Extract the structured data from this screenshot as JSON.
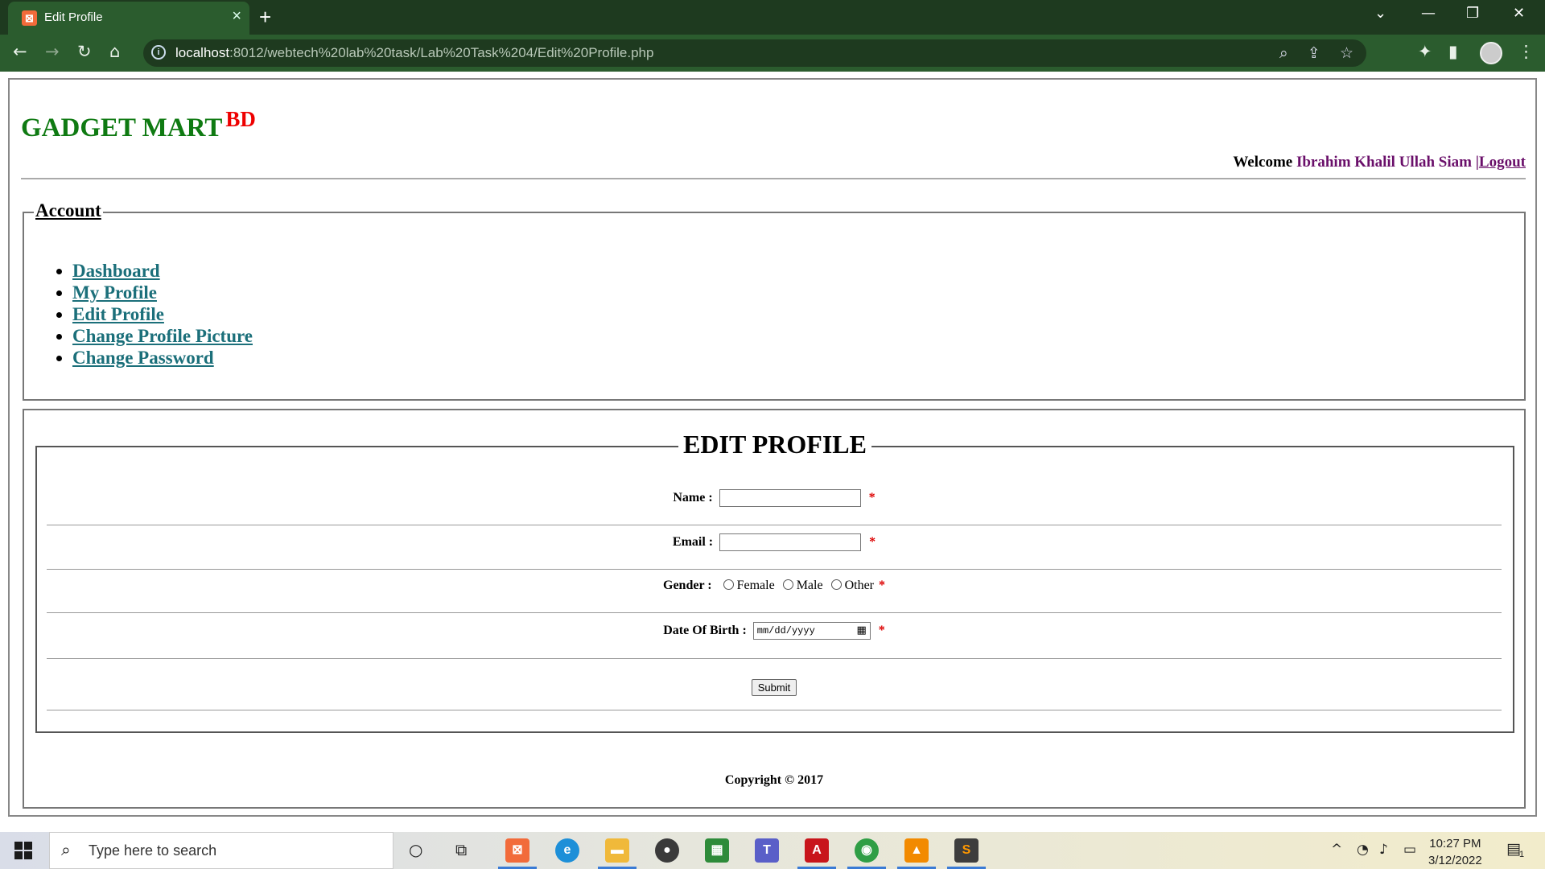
{
  "browser": {
    "tab_title": "Edit Profile",
    "url_host": "localhost",
    "url_rest": ":8012/webtech%20lab%20task/Lab%20Task%204/Edit%20Profile.php"
  },
  "site": {
    "brand": "GADGET MART",
    "brand_sup": "BD",
    "welcome_prefix": "Welcome",
    "user_name": "Ibrahim Khalil Ullah Siam",
    "separator": "|",
    "logout": "Logout"
  },
  "account": {
    "legend": "Account",
    "items": [
      {
        "label": "Dashboard"
      },
      {
        "label": "My Profile"
      },
      {
        "label": "Edit Profile"
      },
      {
        "label": "Change Profile Picture"
      },
      {
        "label": "Change Password"
      }
    ]
  },
  "form": {
    "legend": "EDIT PROFILE",
    "name_label": "Name :",
    "email_label": "Email :",
    "gender_label": "Gender :",
    "gender_options": [
      "Female",
      "Male",
      "Other"
    ],
    "dob_label": "Date Of Birth :",
    "dob_placeholder": "mm/dd/yyyy",
    "required_mark": "*",
    "submit_label": "Submit"
  },
  "footer": {
    "copyright": "Copyright © 2017"
  },
  "taskbar": {
    "search_placeholder": "Type here to search",
    "time": "10:27 PM",
    "date": "3/12/2022",
    "notif_count": "1"
  },
  "colors": {
    "brand": "#0f7a12",
    "brand_sup": "#ee0000",
    "user_link": "#6a0f6a",
    "nav_link": "#1b6f7a",
    "browser_frame": "#2b5c2e"
  }
}
